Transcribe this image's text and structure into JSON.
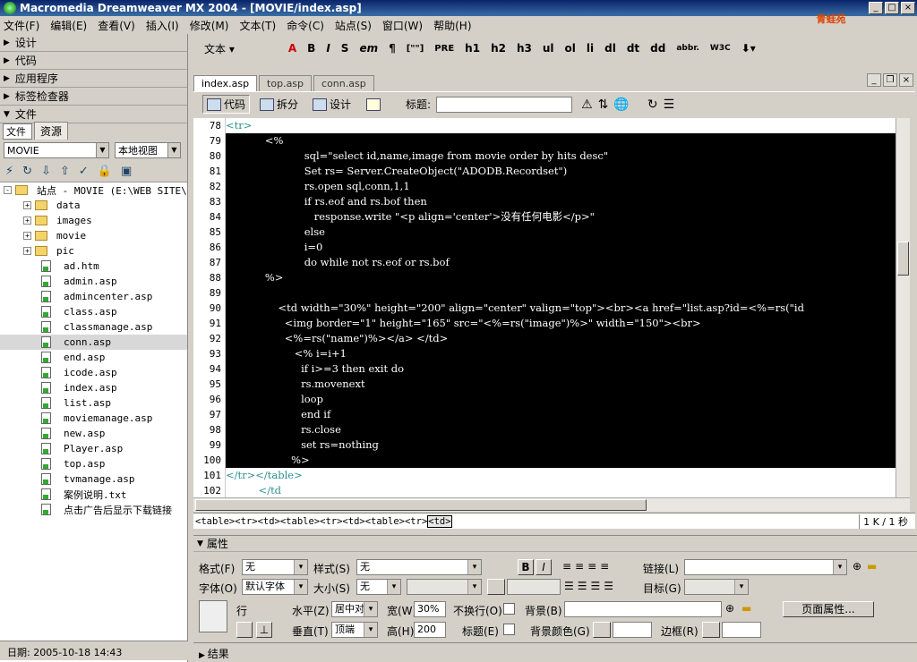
{
  "window": {
    "title": "Macromedia Dreamweaver MX 2004 - [MOVIE/index.asp]"
  },
  "logo_text": "青蛙苑",
  "menu": [
    "文件(F)",
    "编辑(E)",
    "查看(V)",
    "插入(I)",
    "修改(M)",
    "文本(T)",
    "命令(C)",
    "站点(S)",
    "窗口(W)",
    "帮助(H)"
  ],
  "panels": {
    "design": "设计",
    "code": "代码",
    "app": "应用程序",
    "tag": "标签检查器",
    "files": "文件"
  },
  "files_tabs": [
    "文件",
    "资源"
  ],
  "site_select": "MOVIE",
  "view_select": "本地视图",
  "tree": {
    "root": "站点 - MOVIE (E:\\WEB SITE\\",
    "items": [
      {
        "name": "data",
        "type": "folder"
      },
      {
        "name": "images",
        "type": "folder"
      },
      {
        "name": "movie",
        "type": "folder"
      },
      {
        "name": "pic",
        "type": "folder"
      },
      {
        "name": "ad.htm",
        "type": "file"
      },
      {
        "name": "admin.asp",
        "type": "file"
      },
      {
        "name": "admincenter.asp",
        "type": "file"
      },
      {
        "name": "class.asp",
        "type": "file"
      },
      {
        "name": "classmanage.asp",
        "type": "file"
      },
      {
        "name": "conn.asp",
        "type": "file",
        "selected": true
      },
      {
        "name": "end.asp",
        "type": "file"
      },
      {
        "name": "icode.asp",
        "type": "file"
      },
      {
        "name": "index.asp",
        "type": "file"
      },
      {
        "name": "list.asp",
        "type": "file"
      },
      {
        "name": "moviemanage.asp",
        "type": "file"
      },
      {
        "name": "new.asp",
        "type": "file"
      },
      {
        "name": "Player.asp",
        "type": "file"
      },
      {
        "name": "top.asp",
        "type": "file"
      },
      {
        "name": "tvmanage.asp",
        "type": "file"
      },
      {
        "name": "案例说明.txt",
        "type": "file"
      },
      {
        "name": "点击广告后显示下载链接",
        "type": "file"
      }
    ]
  },
  "status_date": "日期: 2005-10-18 14:43",
  "insert_toolbar": {
    "category": "文本",
    "buttons": [
      "B",
      "I",
      "S",
      "em",
      "¶",
      "[\"\"]",
      "PRE",
      "h1",
      "h2",
      "h3",
      "ul",
      "ol",
      "li",
      "dl",
      "dt",
      "dd",
      "abbr.",
      "W3C"
    ]
  },
  "doc_tabs": [
    "index.asp",
    "top.asp",
    "conn.asp"
  ],
  "view_buttons": {
    "code": "代码",
    "split": "拆分",
    "design": "设计"
  },
  "title_label": "标题:",
  "code_lines": [
    {
      "n": "78",
      "text": "<tr>",
      "bg": "white"
    },
    {
      "n": "79",
      "text": "            <%"
    },
    {
      "n": "80",
      "text": "                        sql=\"select id,name,image from movie order by hits desc\""
    },
    {
      "n": "81",
      "text": "                        Set rs= Server.CreateObject(\"ADODB.Recordset\")"
    },
    {
      "n": "82",
      "text": "                        rs.open sql,conn,1,1"
    },
    {
      "n": "83",
      "text": "                        if rs.eof and rs.bof then"
    },
    {
      "n": "84",
      "text": "                           response.write \"<p align='center'>没有任何电影</p>\""
    },
    {
      "n": "85",
      "text": "                        else"
    },
    {
      "n": "86",
      "text": "                        i=0"
    },
    {
      "n": "87",
      "text": "                        do while not rs.eof or rs.bof"
    },
    {
      "n": "88",
      "text": "            %>"
    },
    {
      "n": "89",
      "text": ""
    },
    {
      "n": "90",
      "text": "                <td width=\"30%\" height=\"200\" align=\"center\" valign=\"top\"><br><a href=\"list.asp?id=<%=rs(\"id"
    },
    {
      "n": "91",
      "text": "                  <img border=\"1\" height=\"165\" src=\"<%=rs(\"image\")%>\" width=\"150\"><br>"
    },
    {
      "n": "92",
      "text": "                  <%=rs(\"name\")%></a> </td>"
    },
    {
      "n": "93",
      "text": "                     <% i=i+1"
    },
    {
      "n": "94",
      "text": "                       if i>=3 then exit do"
    },
    {
      "n": "95",
      "text": "                       rs.movenext"
    },
    {
      "n": "96",
      "text": "                       loop"
    },
    {
      "n": "97",
      "text": "                       end if"
    },
    {
      "n": "98",
      "text": "                       rs.close"
    },
    {
      "n": "99",
      "text": "                       set rs=nothing"
    },
    {
      "n": "100",
      "text": "                    %>"
    },
    {
      "n": "101",
      "text": "</tr></table>",
      "bg": "white"
    },
    {
      "n": "102",
      "text": "          </td",
      "bg": "white"
    }
  ],
  "tag_selector": [
    "<table>",
    "<tr>",
    "<td>",
    "<table>",
    "<tr>",
    "<td>",
    "<table>",
    "<tr>",
    "<td>"
  ],
  "size_info": "1 K / 1 秒",
  "properties": {
    "header": "属性",
    "format_label": "格式(F)",
    "format_value": "无",
    "style_label": "样式(S)",
    "style_value": "无",
    "font_label": "字体(O)",
    "font_value": "默认字体",
    "size_label": "大小(S)",
    "size_value": "无",
    "link_label": "链接(L)",
    "target_label": "目标(G)",
    "row_label": "行",
    "horz_label": "水平(Z)",
    "horz_value": "居中对",
    "vert_label": "垂直(T)",
    "vert_value": "顶端",
    "width_label": "宽(W)",
    "width_value": "30%",
    "height_label": "高(H)",
    "height_value": "200",
    "nowrap_label": "不换行(O)",
    "header_label": "标题(E)",
    "bg_label": "背景(B)",
    "bgcolor_label": "背景颜色(G)",
    "border_label": "边框(R)",
    "page_props_button": "页面属性..."
  },
  "results_label": "结果"
}
